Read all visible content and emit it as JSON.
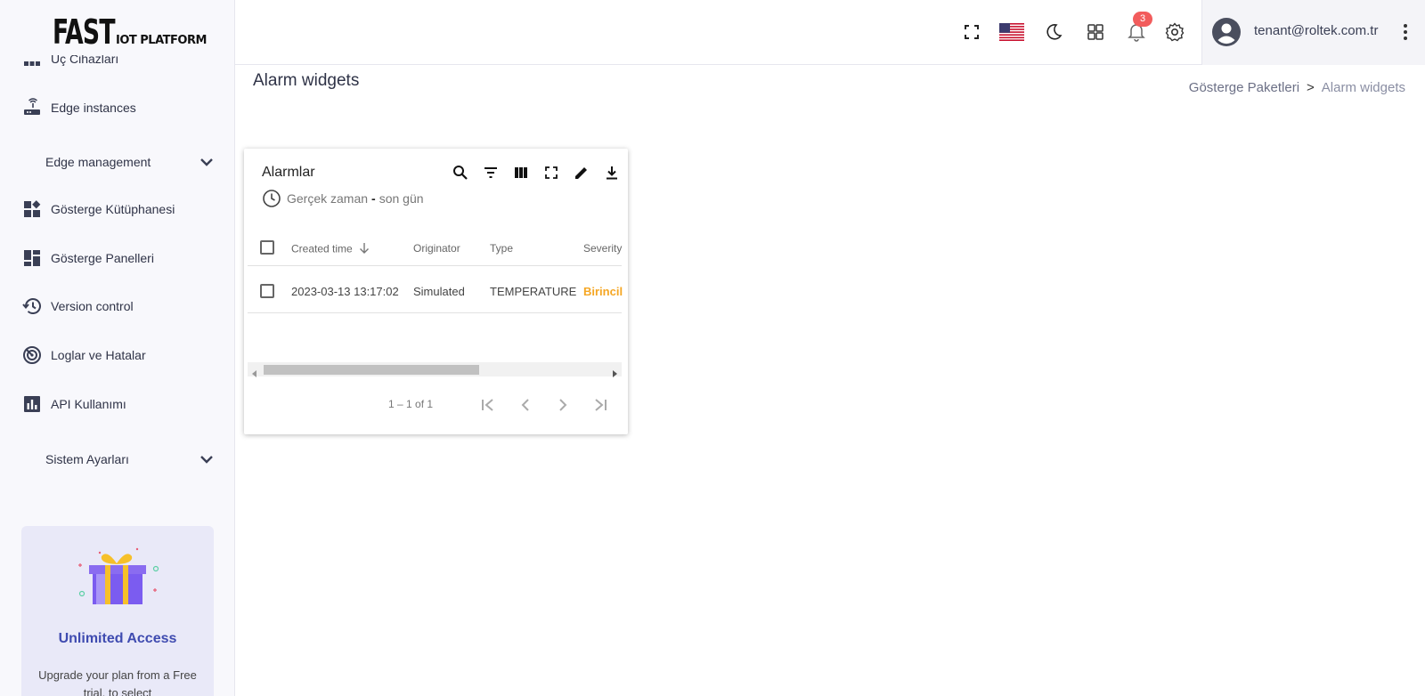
{
  "logo": {
    "main": "FAST",
    "sub": "IOT PLATFORM"
  },
  "sidebar": {
    "items": [
      {
        "label": "Uç Cihazları"
      },
      {
        "label": "Edge instances"
      },
      {
        "label": "Edge management"
      },
      {
        "label": "Gösterge Kütüphanesi"
      },
      {
        "label": "Gösterge Panelleri"
      },
      {
        "label": "Version control"
      },
      {
        "label": "Loglar ve Hatalar"
      },
      {
        "label": "API Kullanımı"
      },
      {
        "label": "Sistem Ayarları"
      }
    ],
    "promo": {
      "title": "Unlimited Access",
      "text": "Upgrade your plan from a Free trial, to select"
    }
  },
  "topbar": {
    "notification_count": "3",
    "user_email": "tenant@roltek.com.tr"
  },
  "page": {
    "title": "Alarm widgets",
    "breadcrumb": {
      "parent": "Gösterge Paketleri",
      "separator": ">",
      "current": "Alarm widgets"
    }
  },
  "widget": {
    "title": "Alarmlar",
    "timewindow": {
      "mode": "Gerçek zaman",
      "dash": "-",
      "range": "son gün"
    },
    "columns": [
      "Created time",
      "Originator",
      "Type",
      "Severity"
    ],
    "rows": [
      {
        "created_time": "2023-03-13 13:17:02",
        "originator": "Simulated",
        "type": "TEMPERATURE",
        "severity": "Birincil"
      }
    ],
    "pagination": {
      "range": "1 – 1 of 1"
    }
  },
  "colors": {
    "accent": "#3f4bb0",
    "severity_major": "#f5a623",
    "badge": "#f25c5c"
  }
}
